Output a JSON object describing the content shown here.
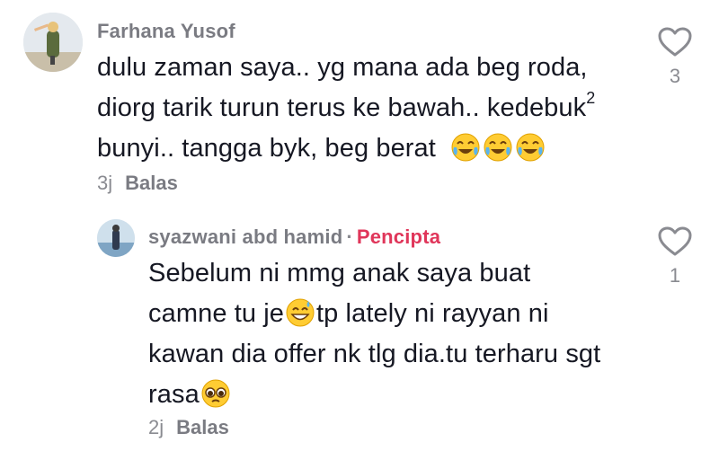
{
  "comments": [
    {
      "username": "Farhana Yusof",
      "lines": [
        "dulu zaman saya.. yg mana ada beg roda,",
        "diorg tarik turun terus ke bawah.. kedebuk",
        "bunyi.. tangga byk, beg berat"
      ],
      "superscript": "2",
      "emoji_after_text": [
        "face-with-tears-of-joy",
        "face-with-tears-of-joy",
        "face-with-tears-of-joy"
      ],
      "time": "3j",
      "reply_label": "Balas",
      "like_count": "3"
    },
    {
      "username": "syazwani abd hamid",
      "separator": "·",
      "badge": "Pencipta",
      "lines": [
        "Sebelum ni mmg anak saya buat",
        "camne tu je",
        "tp lately ni rayyan ni",
        "kawan dia offer nk tlg dia.tu terharu sgt",
        "rasa"
      ],
      "inline_emoji": [
        "grinning-face-with-sweat",
        "pleading-face"
      ],
      "time": "2j",
      "reply_label": "Balas",
      "like_count": "1"
    }
  ],
  "colors": {
    "text": "#161823",
    "muted": "#8a8b91",
    "creator_badge": "#e0365a",
    "emoji_yellow": "#ffcc33"
  }
}
